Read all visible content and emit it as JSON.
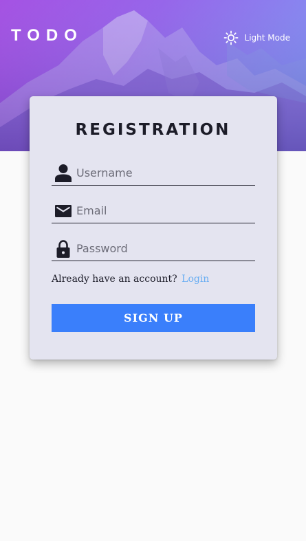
{
  "header": {
    "logo": "TODO",
    "theme_toggle": {
      "label": "Light Mode",
      "icon": "sun-icon"
    }
  },
  "colors": {
    "hero_gradient_start": "#9b3fe0",
    "hero_gradient_end": "#6f8bf2",
    "card_background": "#e4e4f0",
    "primary_button": "#3a7ffb",
    "link": "#6aaef2",
    "page_background": "#fafafa"
  },
  "form": {
    "title": "REGISTRATION",
    "fields": [
      {
        "icon": "user-icon",
        "placeholder": "Username",
        "value": ""
      },
      {
        "icon": "envelope-icon",
        "placeholder": "Email",
        "value": ""
      },
      {
        "icon": "lock-icon",
        "placeholder": "Password",
        "value": ""
      }
    ],
    "account_prompt": "Already have an account?",
    "login_link": "Login",
    "submit_label": "SIGN UP"
  }
}
